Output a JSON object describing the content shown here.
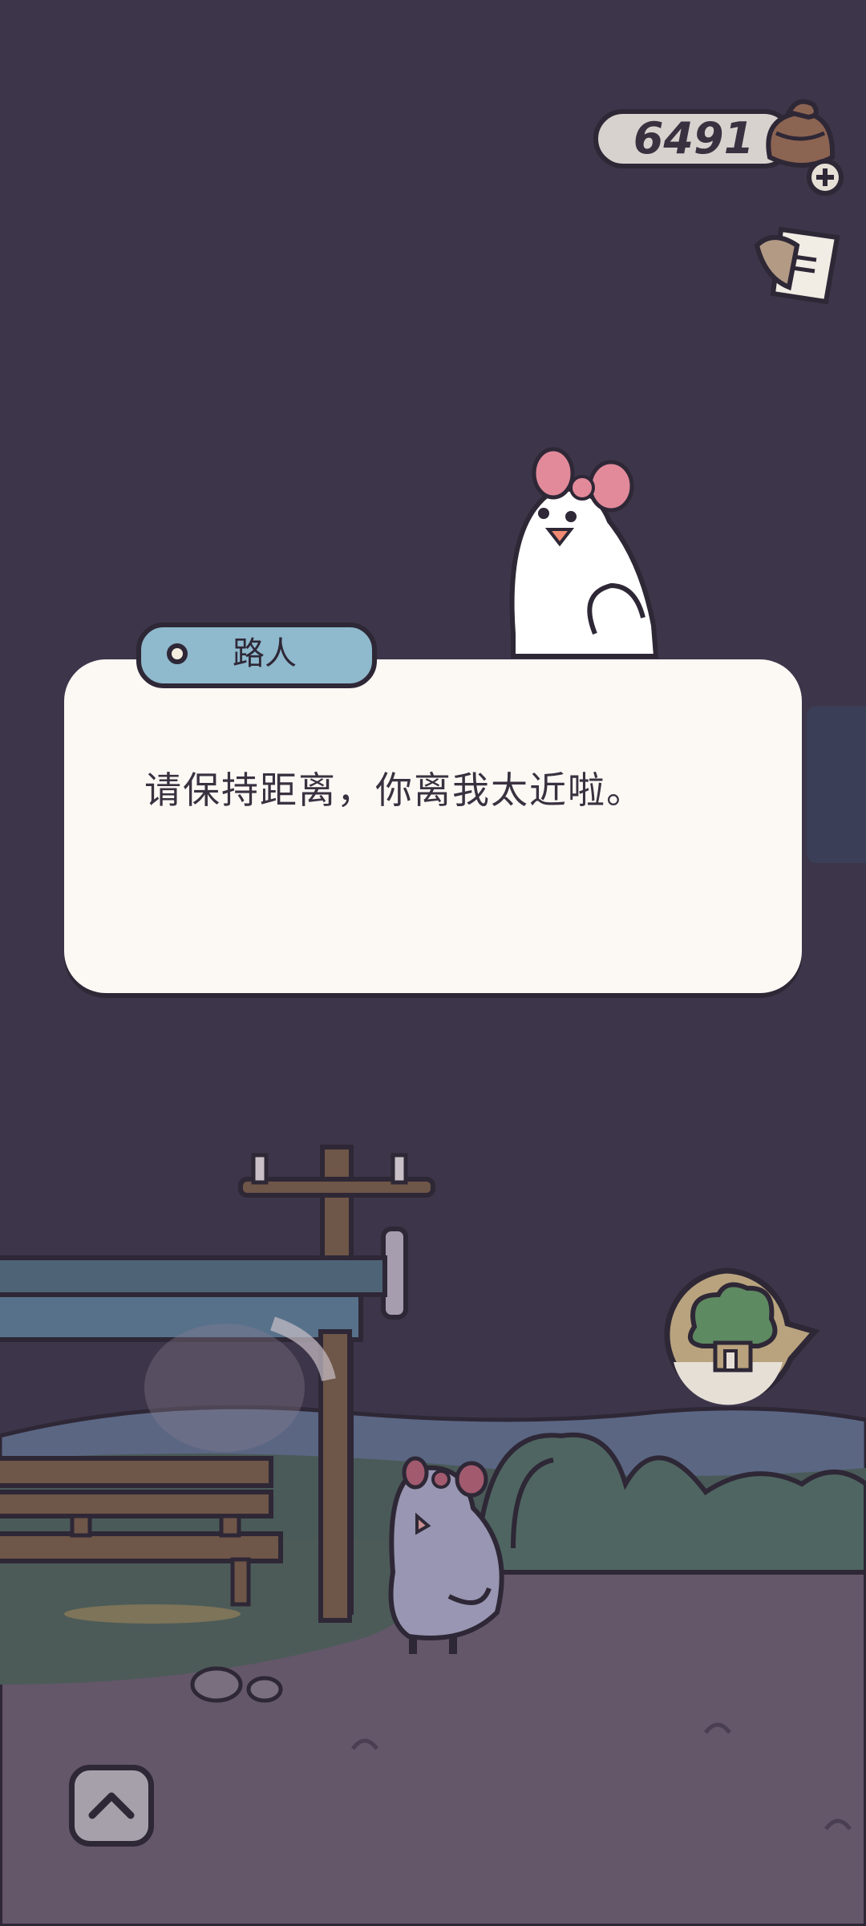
{
  "hud": {
    "currency_value": "6491",
    "currency_icon": "acorn-cake-icon",
    "add_icon": "plus-icon",
    "notes_icon": "memo-note-icon"
  },
  "dialog": {
    "speaker": "路人",
    "text": "请保持距离，你离我太近啦。"
  },
  "scene": {
    "characters": [
      "white-pigeon-with-bow",
      "purple-pigeon-with-bow"
    ],
    "tree_icon": "tree-house-icon",
    "up_icon": "chevron-up-icon"
  },
  "colors": {
    "background": "#3d3549",
    "dialog": "#fcf9f5",
    "speaker_tab": "#8fb9cd",
    "outline": "#2e2736",
    "ground": "#64576a"
  }
}
